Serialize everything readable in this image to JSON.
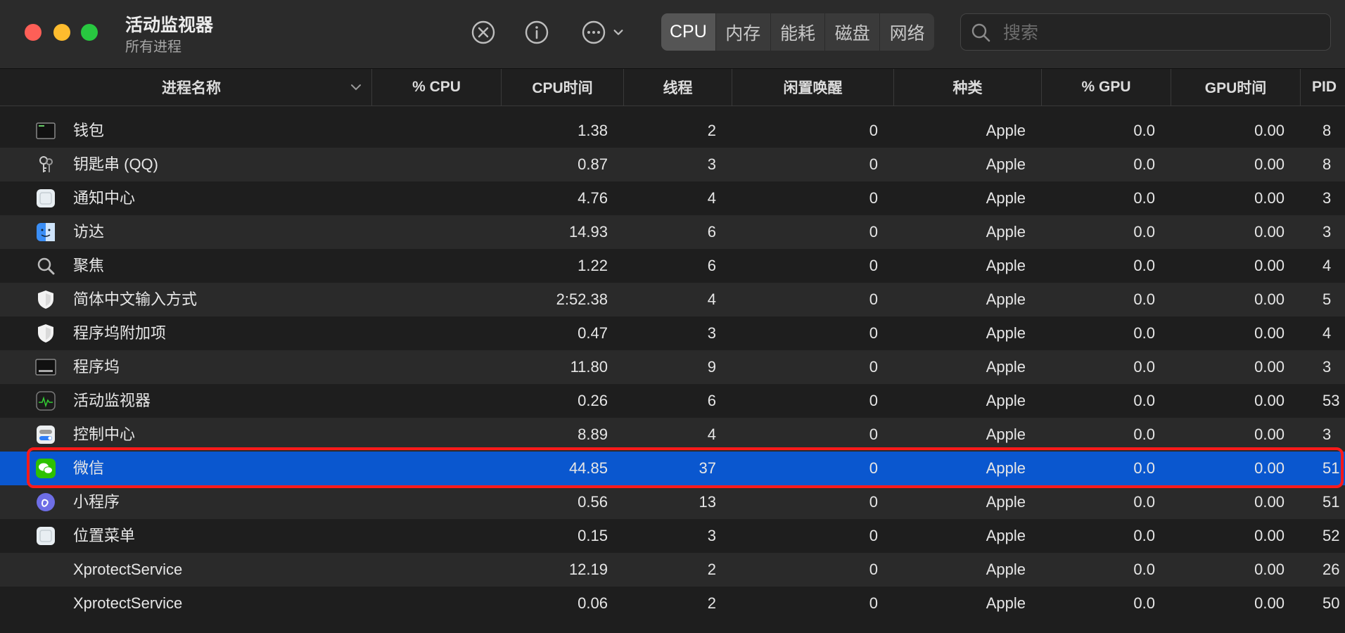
{
  "window": {
    "title": "活动监视器",
    "subtitle": "所有进程"
  },
  "tabs": [
    {
      "label": "CPU",
      "active": true
    },
    {
      "label": "内存",
      "active": false
    },
    {
      "label": "能耗",
      "active": false
    },
    {
      "label": "磁盘",
      "active": false
    },
    {
      "label": "网络",
      "active": false
    }
  ],
  "search": {
    "placeholder": "搜索"
  },
  "columns": [
    "进程名称",
    "% CPU",
    "CPU时间",
    "线程",
    "闲置唤醒",
    "种类",
    "% GPU",
    "GPU时间",
    "PID"
  ],
  "rows": [
    {
      "name": "钱包",
      "cpu_pct": "",
      "cpu_time": "1.38",
      "threads": "2",
      "idle_wakeups": "0",
      "kind": "Apple",
      "gpu_pct": "0.0",
      "gpu_time": "0.00",
      "pid": "8",
      "icon": "wallet-icon"
    },
    {
      "name": "钥匙串 (QQ)",
      "cpu_pct": "",
      "cpu_time": "0.87",
      "threads": "3",
      "idle_wakeups": "0",
      "kind": "Apple",
      "gpu_pct": "0.0",
      "gpu_time": "0.00",
      "pid": "8",
      "icon": "keychain-icon"
    },
    {
      "name": "通知中心",
      "cpu_pct": "",
      "cpu_time": "4.76",
      "threads": "4",
      "idle_wakeups": "0",
      "kind": "Apple",
      "gpu_pct": "0.0",
      "gpu_time": "0.00",
      "pid": "3",
      "icon": "generic-app-icon"
    },
    {
      "name": "访达",
      "cpu_pct": "",
      "cpu_time": "14.93",
      "threads": "6",
      "idle_wakeups": "0",
      "kind": "Apple",
      "gpu_pct": "0.0",
      "gpu_time": "0.00",
      "pid": "3",
      "icon": "finder-icon"
    },
    {
      "name": "聚焦",
      "cpu_pct": "",
      "cpu_time": "1.22",
      "threads": "6",
      "idle_wakeups": "0",
      "kind": "Apple",
      "gpu_pct": "0.0",
      "gpu_time": "0.00",
      "pid": "4",
      "icon": "spotlight-icon"
    },
    {
      "name": "简体中文输入方式",
      "cpu_pct": "",
      "cpu_time": "2:52.38",
      "threads": "4",
      "idle_wakeups": "0",
      "kind": "Apple",
      "gpu_pct": "0.0",
      "gpu_time": "0.00",
      "pid": "5",
      "icon": "shield-icon"
    },
    {
      "name": "程序坞附加项",
      "cpu_pct": "",
      "cpu_time": "0.47",
      "threads": "3",
      "idle_wakeups": "0",
      "kind": "Apple",
      "gpu_pct": "0.0",
      "gpu_time": "0.00",
      "pid": "4",
      "icon": "shield-icon"
    },
    {
      "name": "程序坞",
      "cpu_pct": "",
      "cpu_time": "11.80",
      "threads": "9",
      "idle_wakeups": "0",
      "kind": "Apple",
      "gpu_pct": "0.0",
      "gpu_time": "0.00",
      "pid": "3",
      "icon": "dock-icon"
    },
    {
      "name": "活动监视器",
      "cpu_pct": "",
      "cpu_time": "0.26",
      "threads": "6",
      "idle_wakeups": "0",
      "kind": "Apple",
      "gpu_pct": "0.0",
      "gpu_time": "0.00",
      "pid": "53",
      "icon": "activity-monitor-icon"
    },
    {
      "name": "控制中心",
      "cpu_pct": "",
      "cpu_time": "8.89",
      "threads": "4",
      "idle_wakeups": "0",
      "kind": "Apple",
      "gpu_pct": "0.0",
      "gpu_time": "0.00",
      "pid": "3",
      "icon": "control-center-icon"
    },
    {
      "name": "微信",
      "cpu_pct": "",
      "cpu_time": "44.85",
      "threads": "37",
      "idle_wakeups": "0",
      "kind": "Apple",
      "gpu_pct": "0.0",
      "gpu_time": "0.00",
      "pid": "51",
      "icon": "wechat-icon",
      "selected": true
    },
    {
      "name": "小程序",
      "cpu_pct": "",
      "cpu_time": "0.56",
      "threads": "13",
      "idle_wakeups": "0",
      "kind": "Apple",
      "gpu_pct": "0.0",
      "gpu_time": "0.00",
      "pid": "51",
      "icon": "mini-program-icon"
    },
    {
      "name": "位置菜单",
      "cpu_pct": "",
      "cpu_time": "0.15",
      "threads": "3",
      "idle_wakeups": "0",
      "kind": "Apple",
      "gpu_pct": "0.0",
      "gpu_time": "0.00",
      "pid": "52",
      "icon": "generic-app-icon"
    },
    {
      "name": "XprotectService",
      "cpu_pct": "",
      "cpu_time": "12.19",
      "threads": "2",
      "idle_wakeups": "0",
      "kind": "Apple",
      "gpu_pct": "0.0",
      "gpu_time": "0.00",
      "pid": "26",
      "icon": ""
    },
    {
      "name": "XprotectService",
      "cpu_pct": "",
      "cpu_time": "0.06",
      "threads": "2",
      "idle_wakeups": "0",
      "kind": "Apple",
      "gpu_pct": "0.0",
      "gpu_time": "0.00",
      "pid": "50",
      "icon": ""
    }
  ]
}
